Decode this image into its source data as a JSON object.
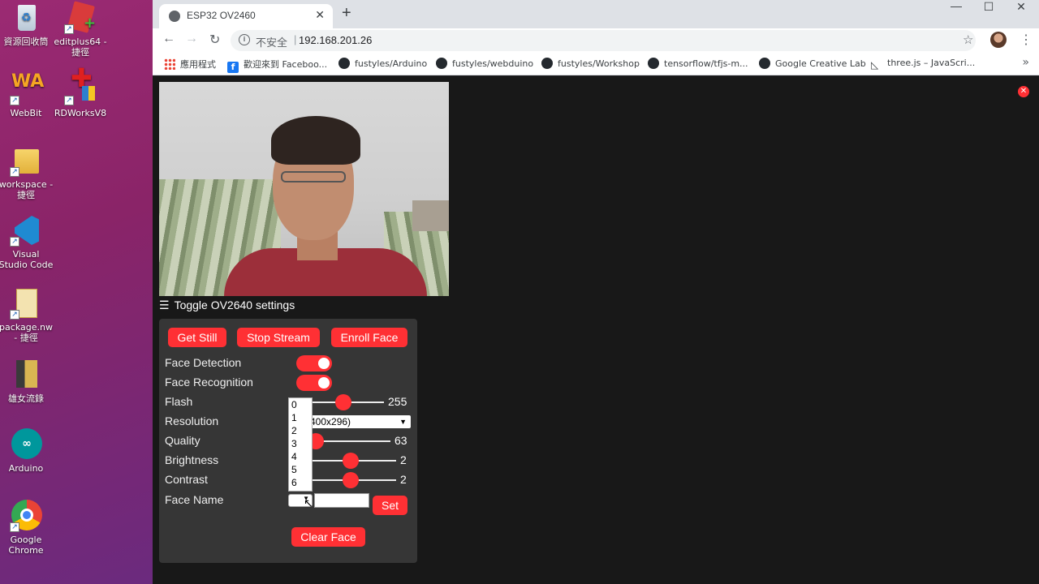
{
  "desktop": {
    "icons": [
      {
        "label": "資源回收筒"
      },
      {
        "label": "editplus64 - 捷徑"
      },
      {
        "label": "WebBit"
      },
      {
        "label": "RDWorksV8"
      },
      {
        "label": "workspace - 捷徑"
      },
      {
        "label": "Visual Studio Code"
      },
      {
        "label": "package.nw - 捷徑"
      },
      {
        "label": "雄女流錄"
      },
      {
        "label": "Arduino"
      },
      {
        "label": "Google Chrome"
      }
    ]
  },
  "browser": {
    "tab_title": "ESP32 OV2460",
    "insecure_label": "不安全",
    "url": "192.168.201.26",
    "bookmarks": [
      {
        "label": "應用程式",
        "icon": "apps-icon"
      },
      {
        "label": "歡迎來到 Faceboo...",
        "icon": "facebook-icon"
      },
      {
        "label": "fustyles/Arduino",
        "icon": "github-icon"
      },
      {
        "label": "fustyles/webduino",
        "icon": "github-icon"
      },
      {
        "label": "fustyles/Workshop",
        "icon": "github-icon"
      },
      {
        "label": "tensorflow/tfjs-m...",
        "icon": "github-icon"
      },
      {
        "label": "Google Creative Lab",
        "icon": "github-icon"
      },
      {
        "label": "three.js – JavaScri...",
        "icon": "threejs-icon"
      }
    ],
    "more_label": "»"
  },
  "app": {
    "toggle_label": "Toggle OV2640 settings",
    "buttons": {
      "get_still": "Get Still",
      "stop_stream": "Stop Stream",
      "enroll_face": "Enroll Face",
      "set": "Set",
      "clear_face": "Clear Face"
    },
    "rows": {
      "face_detection": "Face Detection",
      "face_recognition": "Face Recognition",
      "flash": "Flash",
      "resolution": "Resolution",
      "quality": "Quality",
      "brightness": "Brightness",
      "contrast": "Contrast",
      "face_name": "Face Name"
    },
    "values": {
      "face_detection_on": true,
      "face_recognition_on": true,
      "flash_max": "255",
      "resolution_selected": "400x296)",
      "quality_max": "63",
      "brightness_max": "2",
      "contrast_max": "2"
    },
    "face_name_options": [
      "0",
      "1",
      "2",
      "3",
      "4",
      "5",
      "6"
    ],
    "colors": {
      "accent": "#ff3034",
      "panel": "#363636",
      "page_bg": "#181818"
    }
  }
}
